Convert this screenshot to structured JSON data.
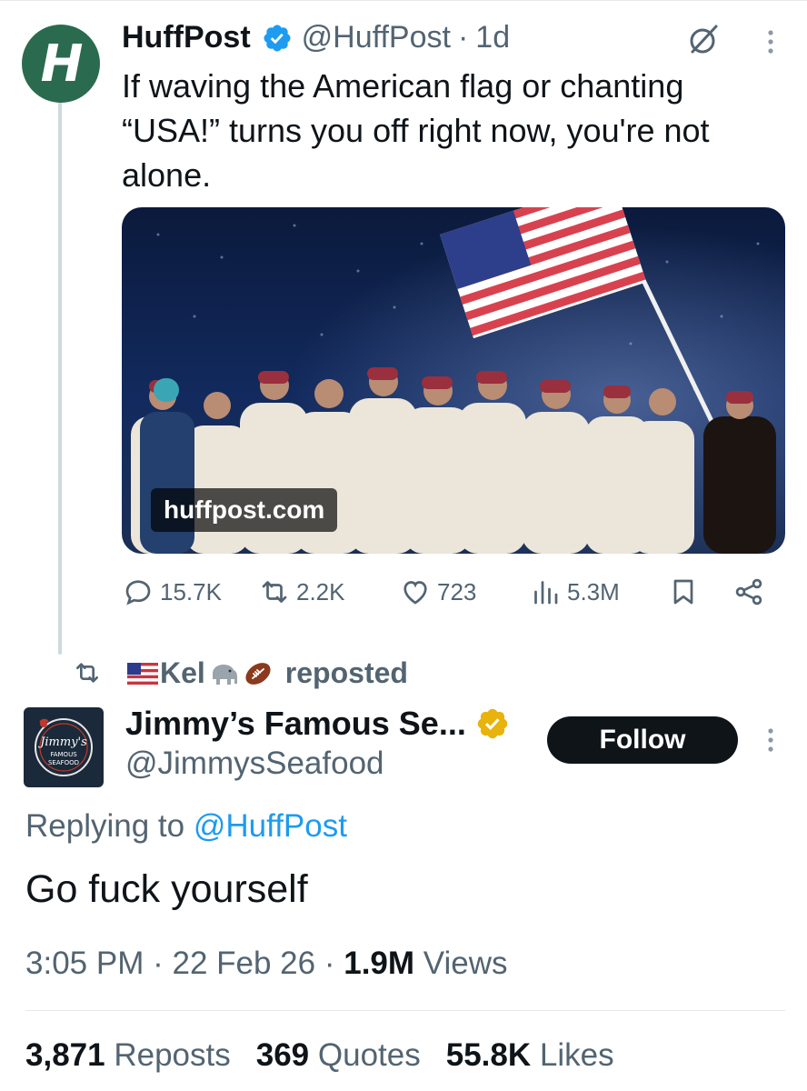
{
  "parent_tweet": {
    "avatar_letter": "H",
    "name": "HuffPost",
    "handle": "@HuffPost",
    "separator": "·",
    "time": "1d",
    "text": "If waving the American flag or chanting “USA!” turns you off right now, you're not alone.",
    "media_link": "huffpost.com",
    "actions": {
      "replies": "15.7K",
      "reposts": "2.2K",
      "likes": "723",
      "views": "5.3M"
    }
  },
  "repost_banner": {
    "user": "Kel",
    "label": "reposted"
  },
  "reply_tweet": {
    "name": "Jimmy’s Famous Se...",
    "handle": "@JimmysSeafood",
    "follow_label": "Follow",
    "replying_prefix": "Replying to",
    "replying_to": "@HuffPost",
    "text": "Go fuck yourself",
    "time": "3:05 PM",
    "date": "22 Feb 26",
    "views_count": "1.9M",
    "views_label": "Views",
    "meta_sep": "·",
    "avatar_text": {
      "line1": "Jimmy's",
      "line2": "FAMOUS",
      "line3": "SEAFOOD"
    },
    "stats": {
      "reposts_count": "3,871",
      "reposts_label": "Reposts",
      "quotes_count": "369",
      "quotes_label": "Quotes",
      "likes_count": "55.8K",
      "likes_label": "Likes"
    }
  },
  "colors": {
    "accent": "#1d9bf0",
    "huffpost_green": "#2a6b4f",
    "secondary_text": "#536471",
    "gold_verified": "#e8b30c"
  }
}
